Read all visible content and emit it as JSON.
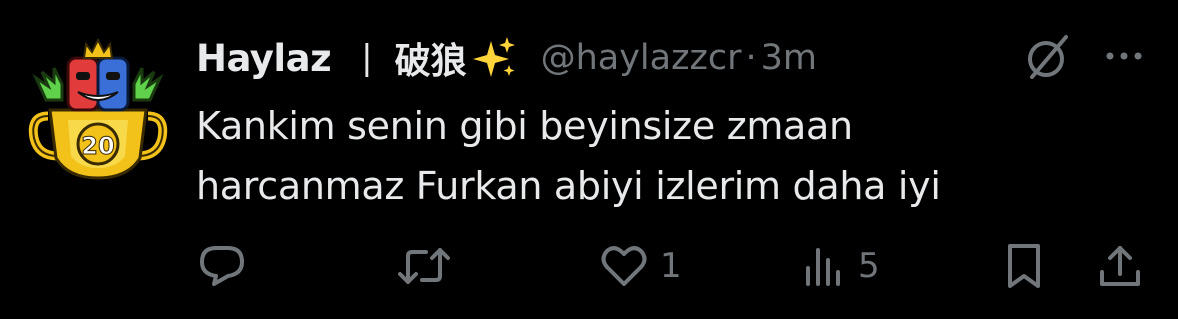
{
  "tweet": {
    "display_name": "Haylaz",
    "separator": "|",
    "display_name_extra": "破狼",
    "emoji_icon": "sparkles-icon",
    "handle": "@haylazzcr",
    "dot": "·",
    "time": "3m",
    "text_line1": "Kankim senin gibi beyinsize zmaan",
    "text_line2": "harcanmaz Furkan abiyi izlerim daha iyi",
    "avatar_badge_number": "20"
  },
  "actions": {
    "reply_count": "",
    "retweet_count": "",
    "like_count": "1",
    "views_count": "5"
  },
  "colors": {
    "background": "#000000",
    "primary_text": "#e7e9ea",
    "secondary_text": "#71767b",
    "sparkle": "#ffd43b",
    "avatar_gold": "#f2c21a"
  },
  "icons": {
    "reply": "reply-icon",
    "retweet": "retweet-icon",
    "like": "heart-icon",
    "views": "views-icon",
    "bookmark": "bookmark-icon",
    "share": "share-icon",
    "grok": "grok-icon",
    "more": "more-icon"
  }
}
